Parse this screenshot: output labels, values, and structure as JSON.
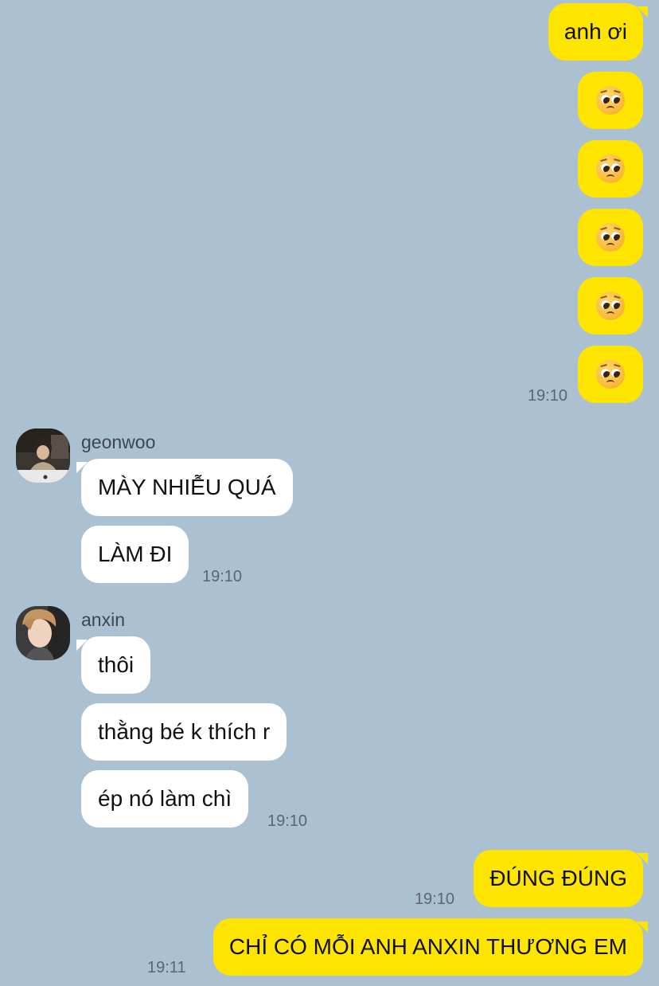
{
  "chat": {
    "me": {
      "msg1": "anh ơi",
      "emoji_icon": "pleading-face-emoji",
      "time1": "19:10",
      "msg_dung": "ĐÚNG ĐÚNG",
      "time_dung": "19:10",
      "msg_last": "CHỈ CÓ MỖI ANH ANXIN THƯƠNG EM",
      "time_last": "19:11"
    },
    "geonwoo": {
      "name": "geonwoo",
      "messages": [
        "MÀY NHIỄU QUÁ",
        "LÀM ĐI"
      ],
      "time": "19:10"
    },
    "anxin": {
      "name": "anxin",
      "messages": [
        "thôi",
        "thằng bé k thích r",
        "ép nó làm chì"
      ],
      "time": "19:10"
    }
  },
  "colors": {
    "background": "#abc1d1",
    "my_bubble": "#fee500",
    "their_bubble": "#ffffff"
  }
}
